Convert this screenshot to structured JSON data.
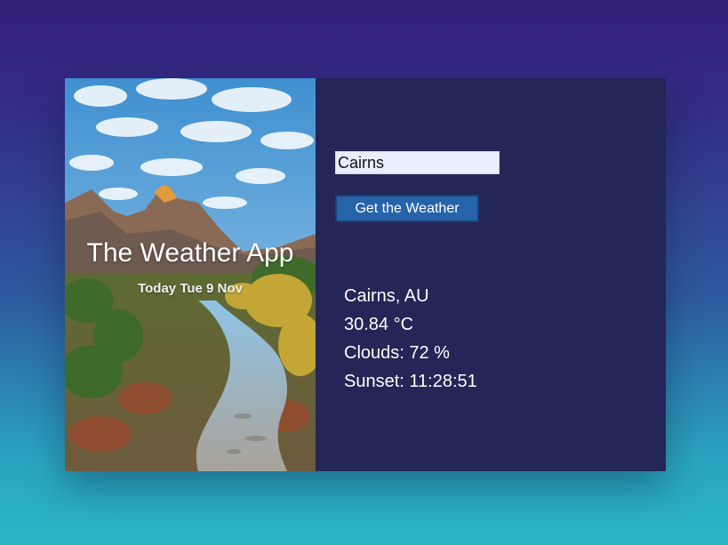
{
  "hero": {
    "title": "The Weather App",
    "date": "Today Tue 9 Nov"
  },
  "search": {
    "value": "Cairns",
    "button_label": "Get the Weather"
  },
  "weather": {
    "location": "Cairns, AU",
    "temperature": "30.84 °C",
    "clouds": "Clouds: 72 %",
    "sunset": "Sunset: 11:28:51"
  },
  "colors": {
    "panel": "#232656",
    "button": "#2663a9",
    "input": "#e9eefc"
  }
}
